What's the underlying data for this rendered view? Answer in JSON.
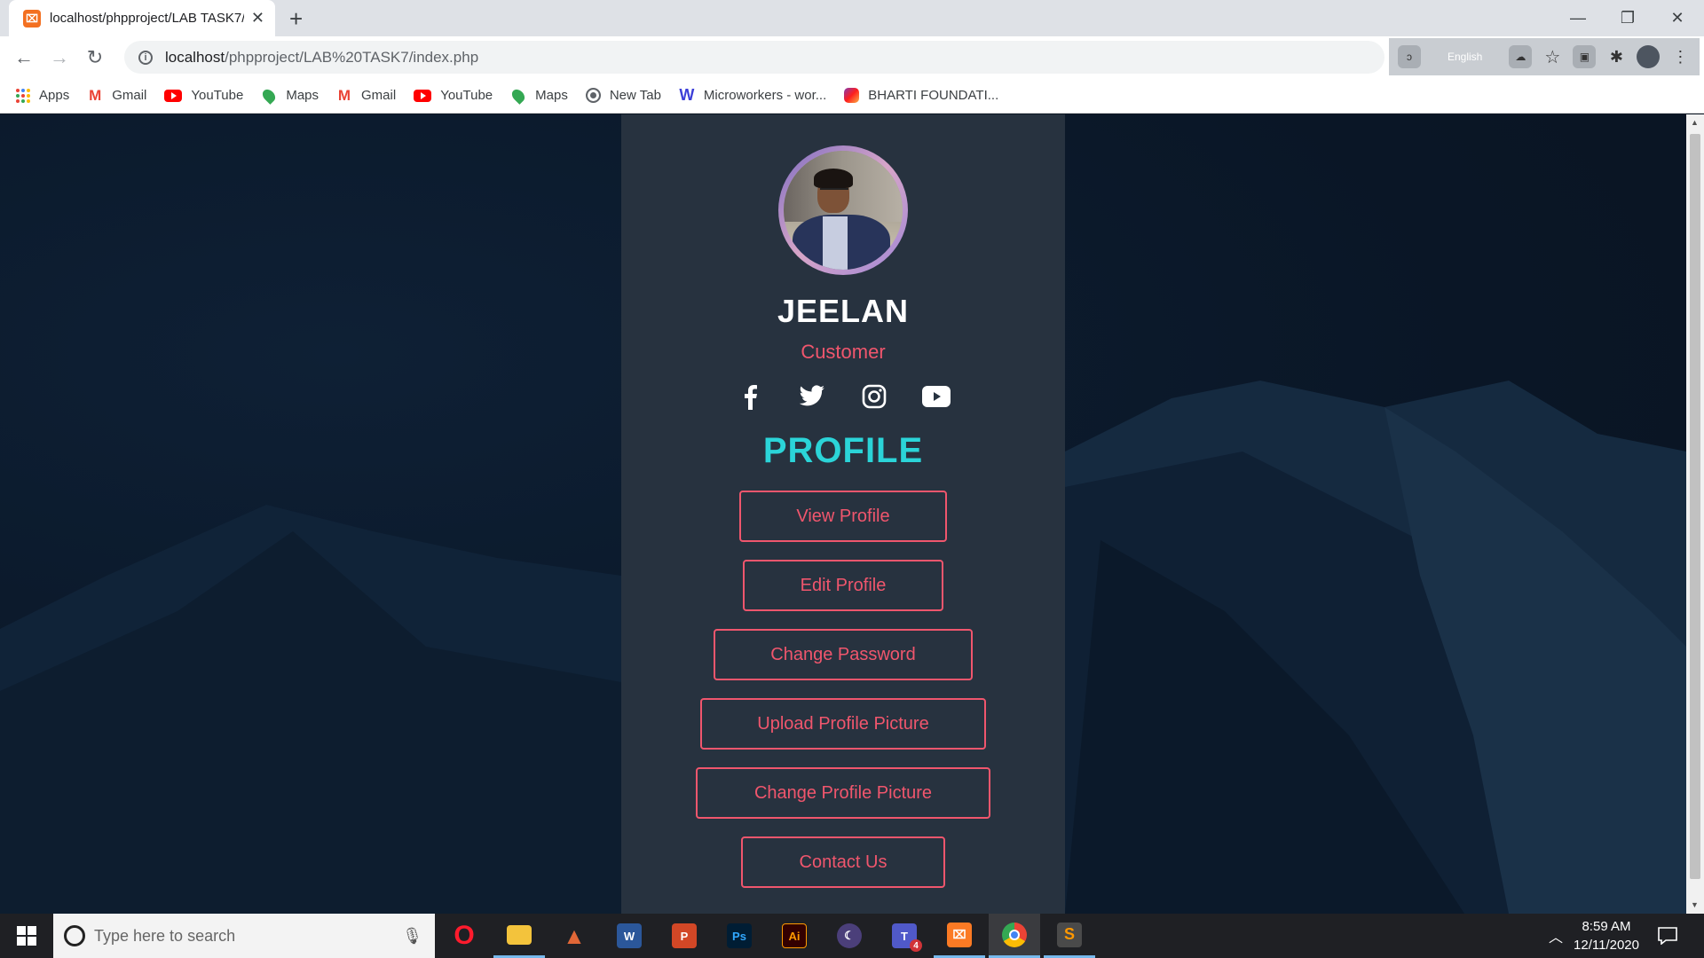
{
  "browser": {
    "tab_title": "localhost/phpproject/LAB TASK7/",
    "tab_favicon": "xampp-icon",
    "url_host": "localhost",
    "url_path": "/phpproject/LAB%20TASK7/index.php",
    "extension_language": "English"
  },
  "bookmarks": [
    {
      "label": "Apps",
      "icon": "apps-grid-icon"
    },
    {
      "label": "Gmail",
      "icon": "gmail-icon"
    },
    {
      "label": "YouTube",
      "icon": "youtube-icon"
    },
    {
      "label": "Maps",
      "icon": "maps-icon"
    },
    {
      "label": "Gmail",
      "icon": "gmail-icon"
    },
    {
      "label": "YouTube",
      "icon": "youtube-icon"
    },
    {
      "label": "Maps",
      "icon": "maps-icon"
    },
    {
      "label": "New Tab",
      "icon": "globe-icon"
    },
    {
      "label": "Microworkers - wor...",
      "icon": "microworkers-icon"
    },
    {
      "label": "BHARTI FOUNDATI...",
      "icon": "instagram-icon"
    }
  ],
  "profile": {
    "name": "JEELAN",
    "role": "Customer",
    "section_title": "PROFILE",
    "socials": [
      "facebook-icon",
      "twitter-icon",
      "instagram-icon",
      "youtube-icon"
    ],
    "buttons": [
      {
        "label": "View Profile"
      },
      {
        "label": "Edit Profile"
      },
      {
        "label": "Change Password"
      },
      {
        "label": "Upload Profile Picture"
      },
      {
        "label": "Change Profile Picture"
      },
      {
        "label": "Contact Us"
      }
    ]
  },
  "colors": {
    "accent_pink": "#f0566d",
    "accent_cyan": "#2bd4d8",
    "card_bg": "#27323f"
  },
  "taskbar": {
    "search_placeholder": "Type here to search",
    "time": "8:59 AM",
    "date": "12/11/2020",
    "teams_badge": "4",
    "apps": [
      "opera-icon",
      "file-explorer-icon",
      "matlab-icon",
      "word-icon",
      "powerpoint-icon",
      "photoshop-icon",
      "illustrator-icon",
      "eclipse-icon",
      "teams-icon",
      "xampp-icon",
      "chrome-icon",
      "sublime-icon"
    ]
  }
}
